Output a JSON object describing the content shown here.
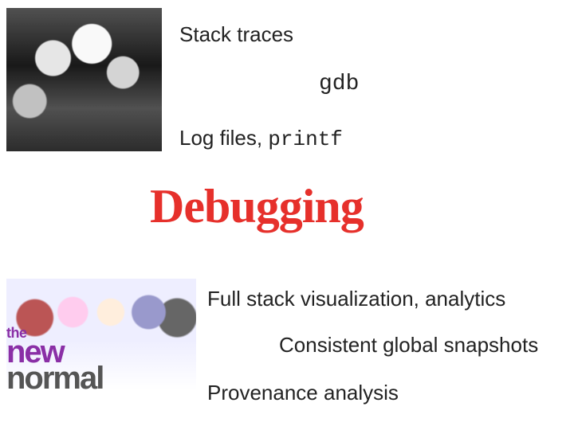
{
  "title": "Debugging",
  "top_items": {
    "a": "Stack traces",
    "b_code": "gdb",
    "c_prefix": "Log files, ",
    "c_code": "printf"
  },
  "bottom_items": {
    "a": "Full stack visualization, analytics",
    "b": "Consistent global snapshots",
    "c": "Provenance analysis"
  },
  "images": {
    "top_alt": "bw-family-photo",
    "bottom_alt": "the-new-normal-cast",
    "logo": {
      "the": "the",
      "new": "new",
      "normal": "normal"
    }
  },
  "colors": {
    "accent": "#e6302b",
    "logo_purple": "#8a2fa6"
  }
}
